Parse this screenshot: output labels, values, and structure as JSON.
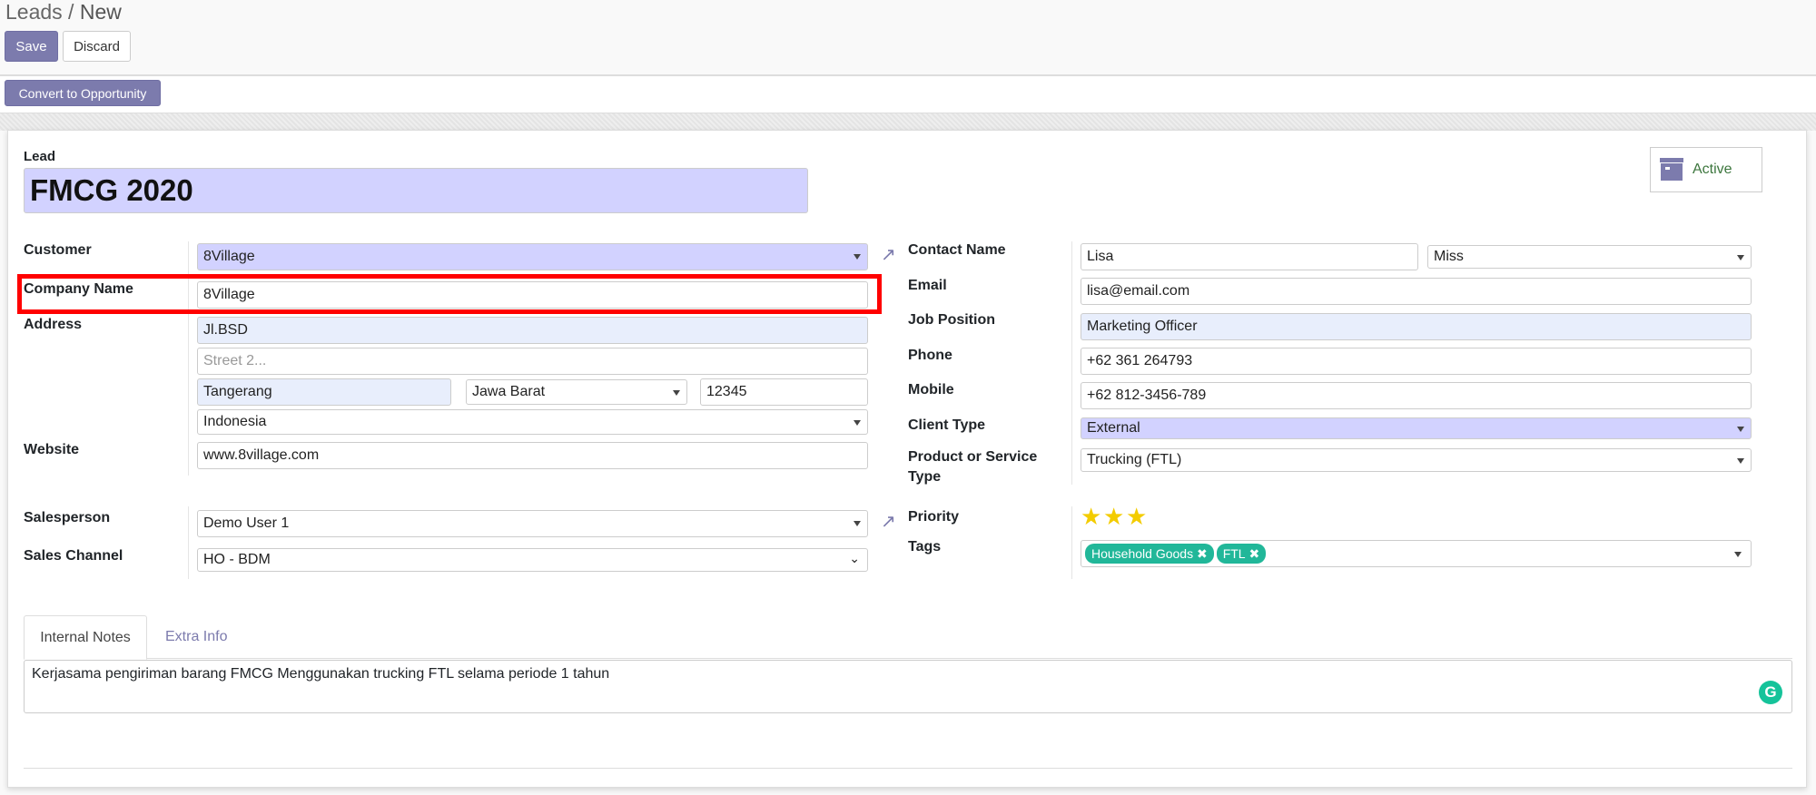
{
  "breadcrumb": {
    "parent": "Leads",
    "current": "New"
  },
  "toolbar": {
    "save_label": "Save",
    "discard_label": "Discard"
  },
  "header": {
    "convert_label": "Convert to Opportunity"
  },
  "status": {
    "active_label": "Active"
  },
  "lead": {
    "label": "Lead",
    "title": "FMCG 2020"
  },
  "left": {
    "customer": {
      "label": "Customer",
      "value": "8Village"
    },
    "company_name": {
      "label": "Company Name",
      "value": "8Village"
    },
    "address": {
      "label": "Address",
      "street": "Jl.BSD",
      "street2_placeholder": "Street 2...",
      "city": "Tangerang",
      "state": "Jawa Barat",
      "zip": "12345",
      "country": "Indonesia"
    },
    "website": {
      "label": "Website",
      "value": "www.8village.com"
    },
    "salesperson": {
      "label": "Salesperson",
      "value": "Demo User 1"
    },
    "sales_channel": {
      "label": "Sales Channel",
      "value": "HO - BDM"
    }
  },
  "right": {
    "contact_name": {
      "label": "Contact Name",
      "value": "Lisa",
      "title": "Miss"
    },
    "email": {
      "label": "Email",
      "value": "lisa@email.com"
    },
    "job_position": {
      "label": "Job Position",
      "value": "Marketing Officer"
    },
    "phone": {
      "label": "Phone",
      "value": "+62 361 264793"
    },
    "mobile": {
      "label": "Mobile",
      "value": "+62 812-3456-789"
    },
    "client_type": {
      "label": "Client Type",
      "value": "External"
    },
    "product_type": {
      "label": "Product or Service Type",
      "value": "Trucking (FTL)"
    },
    "priority": {
      "label": "Priority",
      "stars": 3,
      "max": 3
    },
    "tags": {
      "label": "Tags",
      "items": [
        "Household Goods",
        "FTL"
      ]
    }
  },
  "tabs": [
    {
      "label": "Internal Notes",
      "active": true
    },
    {
      "label": "Extra Info",
      "active": false
    }
  ],
  "notes": "Kerjasama pengiriman barang FMCG Menggunakan trucking FTL selama periode 1 tahun",
  "colors": {
    "primary": "#7c7bad",
    "required": "#d2d2ff",
    "tag": "#21b799",
    "highlight": "#ff0000",
    "active_text": "#3c763d"
  }
}
